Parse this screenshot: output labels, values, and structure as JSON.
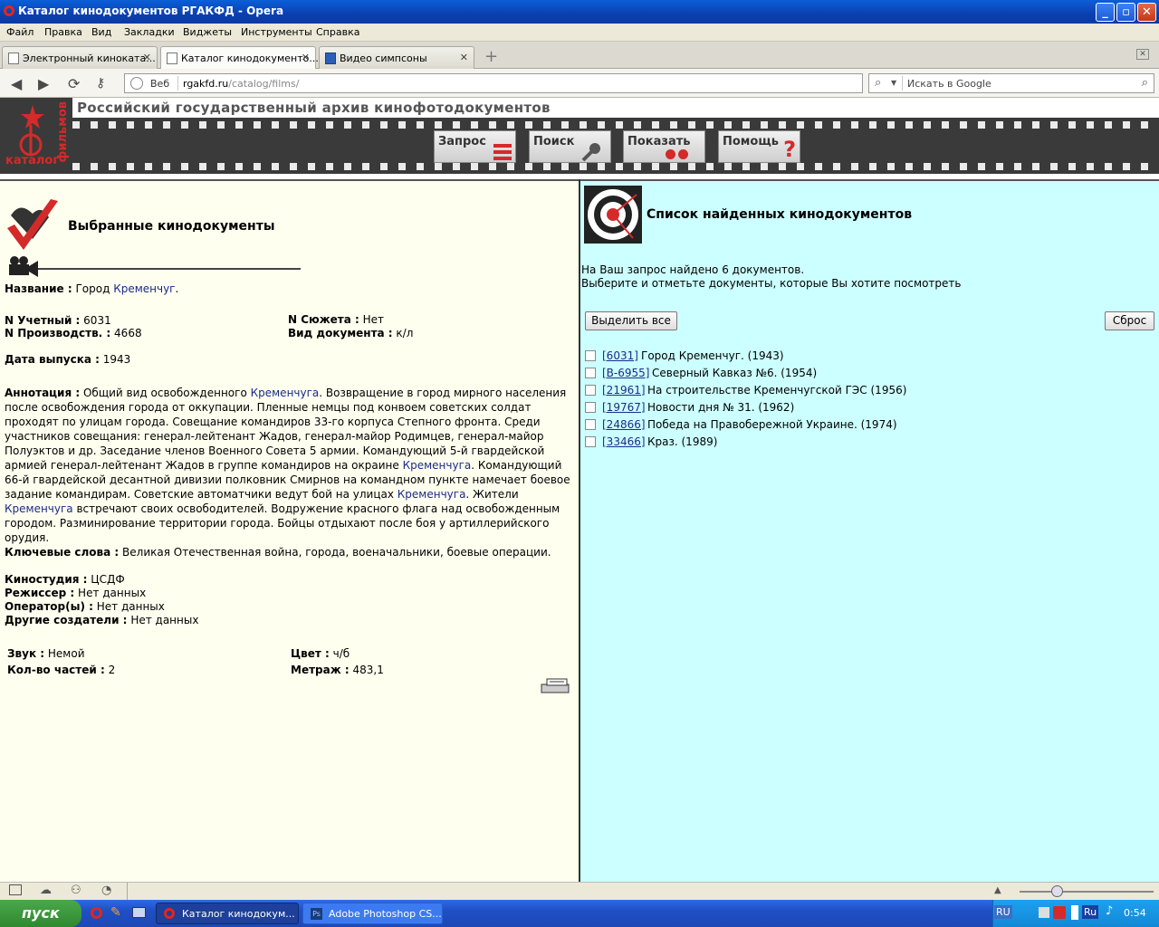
{
  "window": {
    "title": "Каталог кинодокументов РГАКФД - Opera",
    "brand_color": "#0b3fb0"
  },
  "menu": [
    "Файл",
    "Правка",
    "Вид",
    "Закладки",
    "Виджеты",
    "Инструменты",
    "Справка"
  ],
  "tabs": [
    {
      "label": "Электронный киноката...",
      "active": false
    },
    {
      "label": "Каталог кинодокументо...",
      "active": true
    },
    {
      "label": "Видео симпсоны",
      "active": false
    }
  ],
  "address": {
    "zone": "Веб",
    "host": "rgakfd.ru",
    "path": "/catalog/films/"
  },
  "search": {
    "placeholder": "Искать в Google"
  },
  "site": {
    "title": "Российский государственный архив кинофотодокументов",
    "logo_line1": "каталог",
    "logo_line2": "фильмов",
    "nav": [
      {
        "label": "Запрос",
        "icon": "list-icon"
      },
      {
        "label": "Поиск",
        "icon": "magnifier-icon"
      },
      {
        "label": "Показать",
        "icon": "dots-icon"
      },
      {
        "label": "Помощь",
        "icon": "question-icon"
      }
    ],
    "accent_color": "#d42a2a"
  },
  "left": {
    "heading": "Выбранные кинодокументы",
    "name_label": "Название :",
    "name_prefix": "Город ",
    "name_link": "Кременчуг",
    "name_suffix": ".",
    "acc_label": "N Учетный :",
    "acc_value": "6031",
    "plot_label": "N Сюжета :",
    "plot_value": "Нет",
    "prod_label": "N Производств. :",
    "prod_value": "4668",
    "doctype_label": "Вид документа :",
    "doctype_value": "к/л",
    "date_label": "Дата выпуска :",
    "date_value": "1943",
    "annot_label": "Аннотация :",
    "annot_parts": [
      "Общий вид освобожденного ",
      "Кременчуга",
      ". Возвращение в город мирного населения после освобождения города от оккупации. Пленные немцы под конвоем советских солдат проходят по улицам города. Совещание командиров 33-го корпуса Степного фронта. Среди участников совещания: генерал-лейтенант Жадов, генерал-майор Родимцев, генерал-майор Полуэктов и др. Заседание членов Военного Совета 5 армии. Командующий 5-й гвардейской армией генерал-лейтенант Жадов в группе командиров на окраине ",
      "Кременчуга",
      ". Командующий 66-й гвардейской десантной дивизии полковник Смирнов на командном пункте намечает боевое задание командирам. Советские автоматчики ведут бой на улицах ",
      "Кременчуга",
      ". Жители ",
      "Кременчуга",
      " встречают своих освободителей. Водружение красного флага над освобожденным городом. Разминирование территории города. Бойцы отдыхают после боя у артиллерийского орудия."
    ],
    "keywords_label": "Ключевые слова :",
    "keywords_value": "Великая Отечественная война, города, военачальники, боевые операции.",
    "studio_label": "Киностудия :",
    "studio_value": "ЦСДФ",
    "director_label": "Режиссер :",
    "director_value": "Нет данных",
    "operator_label": "Оператор(ы) :",
    "operator_value": "Нет данных",
    "others_label": "Другие создатели :",
    "others_value": "Нет данных",
    "sound_label": "Звук :",
    "sound_value": "Немой",
    "color_label": "Цвет :",
    "color_value": "ч/б",
    "parts_label": "Кол-во частей :",
    "parts_value": "2",
    "length_label": "Метраж :",
    "length_value": "483,1"
  },
  "right": {
    "heading": "Список найденных кинодокументов",
    "found_text": "На Ваш запрос найдено 6 документов.",
    "instruction": "Выберите и отметьте документы, которые Вы хотите посмотреть",
    "select_all": "Выделить все",
    "reset": "Сброс",
    "results": [
      {
        "id": "[6031]",
        "title": "Город Кременчуг. (1943)",
        "checked": false
      },
      {
        "id": "[В-6955]",
        "title": "Северный Кавказ №6. (1954)",
        "checked": false
      },
      {
        "id": "[21961]",
        "title": "На строительстве Кременчугской ГЭС (1956)",
        "checked": false
      },
      {
        "id": "[19767]",
        "title": "Новости дня № 31. (1962)",
        "checked": false
      },
      {
        "id": "[24866]",
        "title": "Победа на Правобережной Украине. (1974)",
        "checked": false
      },
      {
        "id": "[33466]",
        "title": "Краз. (1989)",
        "checked": false
      }
    ],
    "bg_color": "#ccffff"
  },
  "taskbar": {
    "start": "пуск",
    "tasks": [
      {
        "label": "Каталог кинодокум...",
        "active": true
      },
      {
        "label": "Adobe Photoshop CS...",
        "active": false
      }
    ],
    "lang_left": "RU",
    "lang_right": "Ru",
    "clock": "0:54"
  }
}
